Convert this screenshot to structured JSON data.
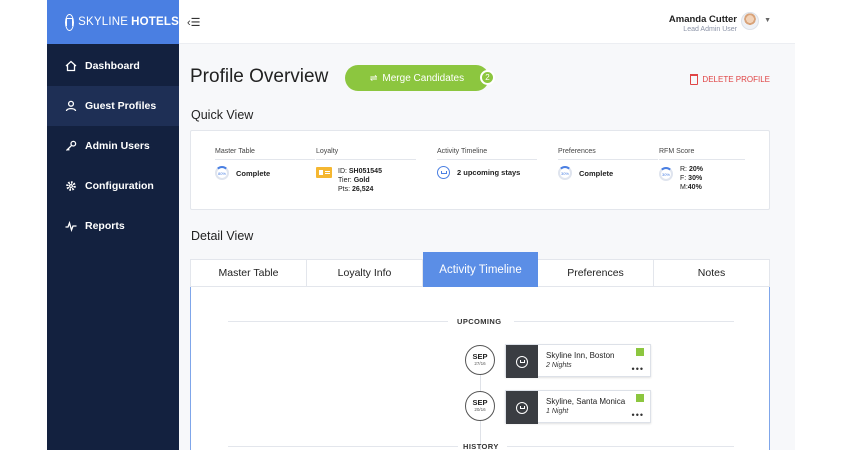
{
  "brand": {
    "name_light": "SKYLINE",
    "name_bold": "HOTELS"
  },
  "sidebar": {
    "items": [
      {
        "label": "Dashboard",
        "icon": "home-icon"
      },
      {
        "label": "Guest Profiles",
        "icon": "user-icon"
      },
      {
        "label": "Admin Users",
        "icon": "key-icon"
      },
      {
        "label": "Configuration",
        "icon": "gear-icon"
      },
      {
        "label": "Reports",
        "icon": "pulse-icon"
      }
    ],
    "active_index": 1
  },
  "user": {
    "name": "Amanda Cutter",
    "role": "Lead Admin User"
  },
  "page": {
    "title": "Profile Overview",
    "merge_label": "Merge Candidates",
    "merge_count": "2",
    "delete_label": "DELETE PROFILE"
  },
  "quick_view": {
    "title": "Quick View",
    "master_table": {
      "label": "Master Table",
      "ring": "80%",
      "value": "Complete"
    },
    "loyalty": {
      "label": "Loyalty",
      "id_prefix": "ID: ",
      "id": "SH051545",
      "tier_prefix": "Tier: ",
      "tier": "Gold",
      "pts_prefix": "Pts: ",
      "pts": "26,524"
    },
    "activity": {
      "label": "Activity Timeline",
      "value": "2 upcoming stays"
    },
    "preferences": {
      "label": "Preferences",
      "ring": "30%",
      "value": "Complete"
    },
    "rfm": {
      "label": "RFM Score",
      "ring": "30%",
      "r_prefix": "R: ",
      "r": "20%",
      "f_prefix": "F: ",
      "f": "30%",
      "m_prefix": "M:",
      "m": "40%"
    }
  },
  "detail_view": {
    "title": "Detail View",
    "tabs": [
      "Master Table",
      "Loyalty Info",
      "Activity Timeline",
      "Preferences",
      "Notes"
    ],
    "active_tab": 2,
    "upcoming_label": "UPCOMING",
    "history_label": "HISTORY",
    "stays": [
      {
        "month": "SEP",
        "date": "27/16",
        "name": "Skyline Inn, Boston",
        "nights": "2 Nights"
      },
      {
        "month": "SEP",
        "date": "20/16",
        "name": "Skyline, Santa Monica",
        "nights": "1 Night"
      }
    ]
  },
  "colors": {
    "sidebar": "#13213f",
    "brand_blue": "#4a7fe2",
    "accent_green": "#8cc63f",
    "danger": "#e04545"
  }
}
